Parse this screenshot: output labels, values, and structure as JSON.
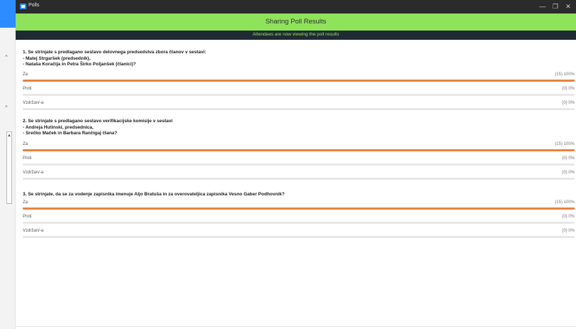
{
  "window": {
    "title": "Polls"
  },
  "banner": {
    "title": "Sharing Poll Results",
    "subtitle": "Attendees are now viewing the poll results"
  },
  "colors": {
    "banner": "#8fe35b",
    "subbanner": "#1f2a32",
    "bar_fill": "#e9833e",
    "track": "#e8e8e8",
    "titlebar": "#2b2b2b",
    "accent": "#2d8cff"
  },
  "titlebar_controls": {
    "minimize": "—",
    "maximize": "❐",
    "close": "✕"
  },
  "sidebar_icons": {
    "caret_1": "^",
    "caret_2": "^",
    "mini": "▲"
  },
  "polls": [
    {
      "question": "1. Se strinjate s predlagano sestavo delovnega predsedstva zbora članov v sestavi:\n- Matej Strgaršek (predsednik),\n- Nataša Koračija in Petra Širko Poljanšek (članici)?",
      "answers": [
        {
          "label": "Za",
          "stat": "(15) 100%",
          "fraction": 1.0
        },
        {
          "label": "Proti",
          "stat": "(0) 0%",
          "fraction": 0.0
        },
        {
          "label": "Vzdržan/-a",
          "stat": "(0) 0%",
          "fraction": 0.0
        }
      ]
    },
    {
      "question": "2. Se strinjate s predlagano sestavo verifikacijske komisije v sestavi\n- Andreja Hutinski, predsednica,\n- Srečko Maček in Barbara Rančigaj člana?",
      "answers": [
        {
          "label": "Za",
          "stat": "(15) 100%",
          "fraction": 1.0
        },
        {
          "label": "Proti",
          "stat": "(0) 0%",
          "fraction": 0.0
        },
        {
          "label": "Vzdržan/-a",
          "stat": "(0) 0%",
          "fraction": 0.0
        }
      ]
    },
    {
      "question": "3. Se strinjate, da se za vodenje zapisnika imenuje Aljo Bratuša in za overovateljica zapisnika Vesno Gaber Podhovnik?",
      "answers": [
        {
          "label": "Za",
          "stat": "(15) 100%",
          "fraction": 1.0
        },
        {
          "label": "Proti",
          "stat": "(0) 0%",
          "fraction": 0.0
        },
        {
          "label": "Vzdržan/-a",
          "stat": "(0) 0%",
          "fraction": 0.0
        }
      ]
    }
  ]
}
